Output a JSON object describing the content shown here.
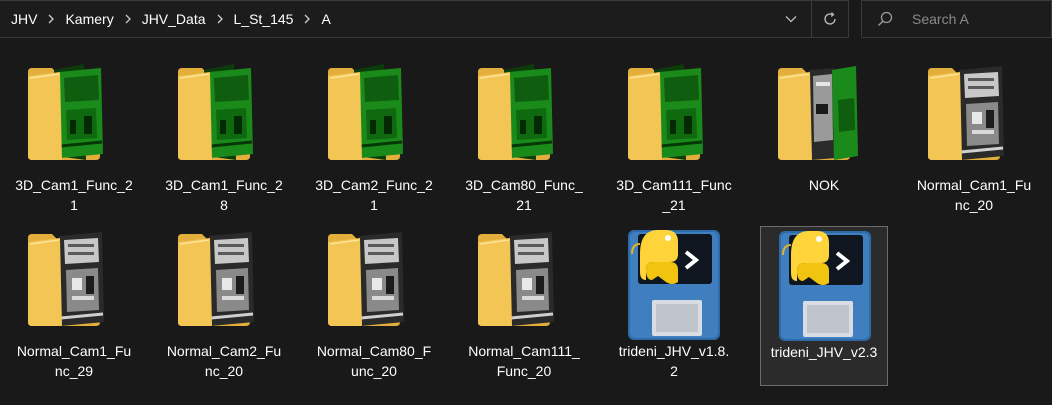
{
  "breadcrumb": [
    "JHV",
    "Kamery",
    "JHV_Data",
    "L_St_145",
    "A"
  ],
  "search": {
    "placeholder": "Search A"
  },
  "items": [
    {
      "name": "3D_Cam1_Func_21",
      "line1": "3D_Cam1_Func_2",
      "line2": "1",
      "type": "folder",
      "preview": "green"
    },
    {
      "name": "3D_Cam1_Func_28",
      "line1": "3D_Cam1_Func_2",
      "line2": "8",
      "type": "folder",
      "preview": "green"
    },
    {
      "name": "3D_Cam2_Func_21",
      "line1": "3D_Cam2_Func_2",
      "line2": "1",
      "type": "folder",
      "preview": "green"
    },
    {
      "name": "3D_Cam80_Func_21",
      "line1": "3D_Cam80_Func_",
      "line2": "21",
      "type": "folder",
      "preview": "green"
    },
    {
      "name": "3D_Cam111_Func_21",
      "line1": "3D_Cam111_Func",
      "line2": "_21",
      "type": "folder",
      "preview": "green"
    },
    {
      "name": "NOK",
      "line1": "NOK",
      "line2": "",
      "type": "folder",
      "preview": "mixed"
    },
    {
      "name": "Normal_Cam1_Func_20",
      "line1": "Normal_Cam1_Fu",
      "line2": "nc_20",
      "type": "folder",
      "preview": "gray"
    },
    {
      "name": "Normal_Cam1_Func_29",
      "line1": "Normal_Cam1_Fu",
      "line2": "nc_29",
      "type": "folder",
      "preview": "gray"
    },
    {
      "name": "Normal_Cam2_Func_20",
      "line1": "Normal_Cam2_Fu",
      "line2": "nc_20",
      "type": "folder",
      "preview": "gray"
    },
    {
      "name": "Normal_Cam80_Func_20",
      "line1": "Normal_Cam80_F",
      "line2": "unc_20",
      "type": "folder",
      "preview": "gray"
    },
    {
      "name": "Normal_Cam111_Func_20",
      "line1": "Normal_Cam111_",
      "line2": "Func_20",
      "type": "folder",
      "preview": "gray"
    },
    {
      "name": "trideni_JHV_v1.8.2",
      "line1": "trideni_JHV_v1.8.",
      "line2": "2",
      "type": "python-file"
    },
    {
      "name": "trideni_JHV_v2.3",
      "line1": "trideni_JHV_v2.3",
      "line2": "",
      "type": "python-file",
      "selected": true
    }
  ],
  "colors": {
    "background": "#191919",
    "folder": "#f3c554",
    "folder_back": "#e3ae3b",
    "preview_green": "#1a8a1a",
    "preview_gray": "#2a2a2a",
    "python_blue": "#3f7fbf",
    "python_yellow": "#ffd43b"
  }
}
